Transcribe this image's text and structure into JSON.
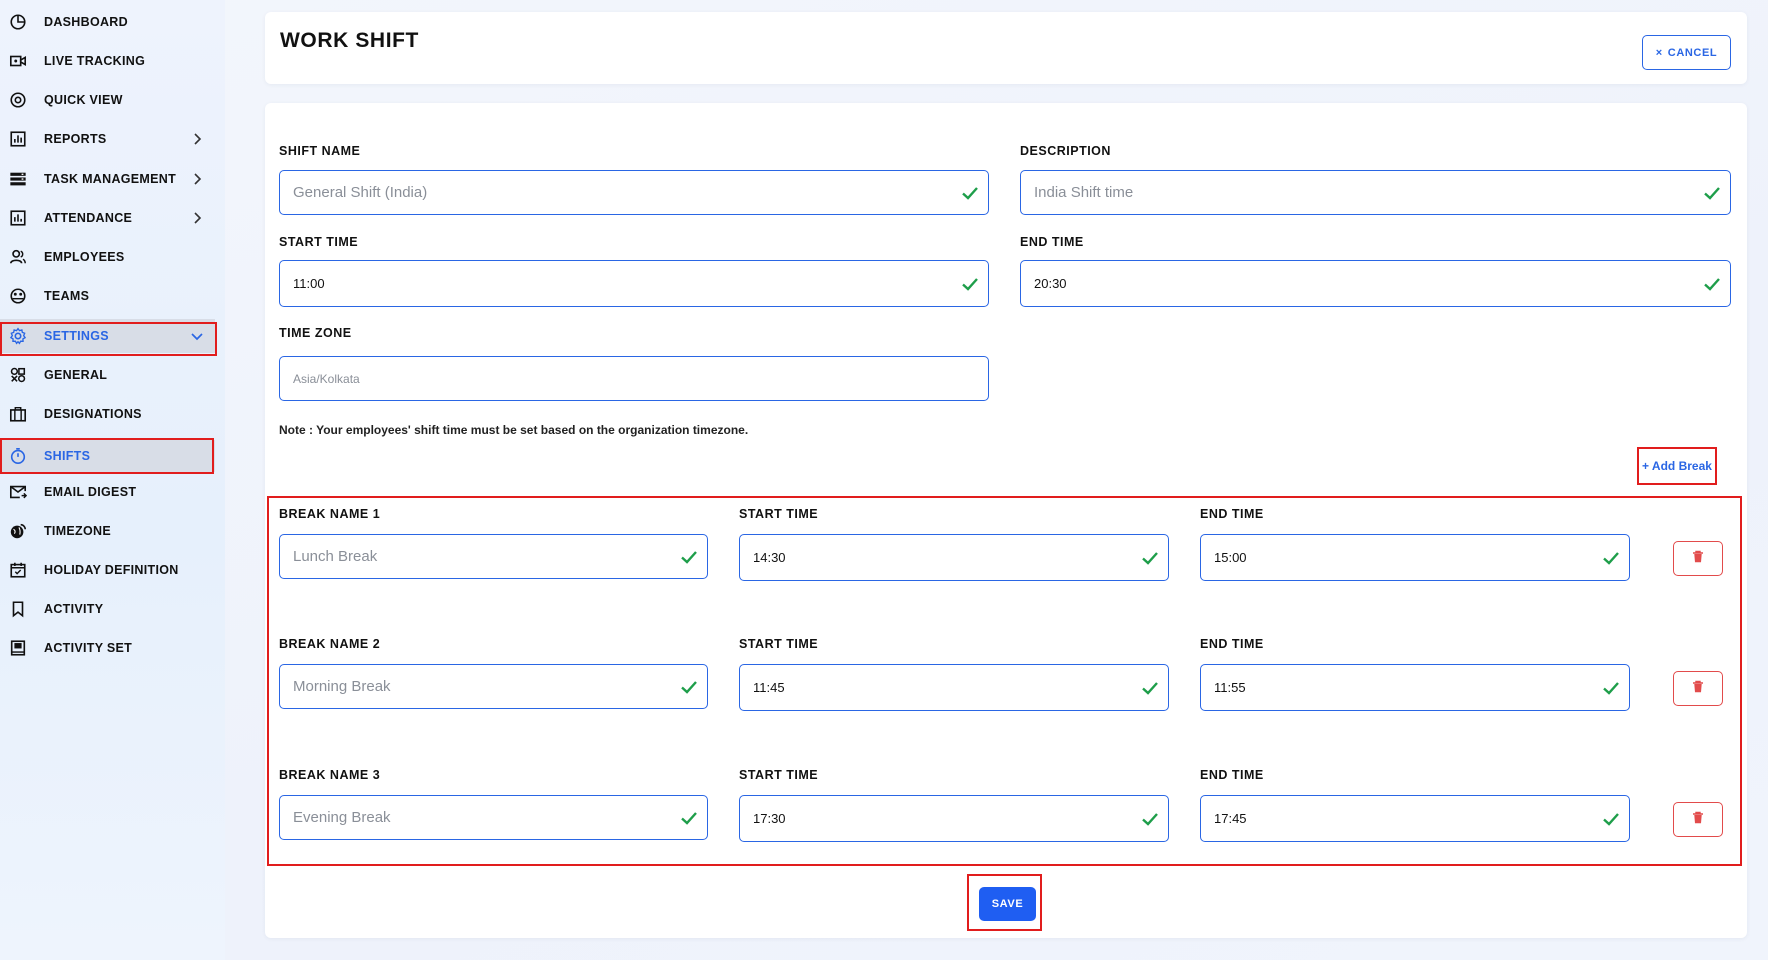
{
  "sidebar": {
    "items": [
      {
        "label": "DASHBOARD",
        "icon": "clock-pie-icon"
      },
      {
        "label": "LIVE TRACKING",
        "icon": "video-icon"
      },
      {
        "label": "QUICK VIEW",
        "icon": "eye-icon"
      },
      {
        "label": "REPORTS",
        "icon": "report-chart-icon"
      },
      {
        "label": "TASK MANAGEMENT",
        "icon": "stack-icon"
      },
      {
        "label": "ATTENDANCE",
        "icon": "attendance-chart-icon"
      },
      {
        "label": "EMPLOYEES",
        "icon": "people-icon"
      },
      {
        "label": "TEAMS",
        "icon": "team-icon"
      },
      {
        "label": "SETTINGS",
        "icon": "gear-icon"
      },
      {
        "label": "GENERAL",
        "icon": "general-icon"
      },
      {
        "label": "DESIGNATIONS",
        "icon": "briefcase-icon"
      },
      {
        "label": "SHIFTS",
        "icon": "stopwatch-icon"
      },
      {
        "label": "EMAIL DIGEST",
        "icon": "mail-icon"
      },
      {
        "label": "TIMEZONE",
        "icon": "globe-icon"
      },
      {
        "label": "HOLIDAY DEFINITION",
        "icon": "calendar-icon"
      },
      {
        "label": "ACTIVITY",
        "icon": "bookmark-icon"
      },
      {
        "label": "ACTIVITY SET",
        "icon": "book-icon"
      }
    ]
  },
  "header": {
    "title": "WORK SHIFT",
    "cancel_label": "CANCEL",
    "cancel_icon": "×"
  },
  "form": {
    "shift_name": {
      "label": "SHIFT NAME",
      "value": "General Shift (India)"
    },
    "description": {
      "label": "DESCRIPTION",
      "value": "India Shift time"
    },
    "start_time": {
      "label": "START TIME",
      "value": "11:00"
    },
    "end_time": {
      "label": "END TIME",
      "value": "20:30"
    },
    "time_zone": {
      "label": "TIME ZONE",
      "value": "Asia/Kolkata"
    },
    "note": "Note : Your employees' shift time must be set based on the organization timezone.",
    "add_break_label": "+ Add Break"
  },
  "breaks": [
    {
      "name_label": "BREAK NAME 1",
      "name": "Lunch Break",
      "start_label": "START TIME",
      "start": "14:30",
      "end_label": "END TIME",
      "end": "15:00"
    },
    {
      "name_label": "BREAK NAME 2",
      "name": "Morning Break",
      "start_label": "START TIME",
      "start": "11:45",
      "end_label": "END TIME",
      "end": "11:55"
    },
    {
      "name_label": "BREAK NAME 3",
      "name": "Evening Break",
      "start_label": "START TIME",
      "start": "17:30",
      "end_label": "END TIME",
      "end": "17:45"
    }
  ],
  "save_label": "SAVE",
  "colors": {
    "accent": "#2a66e4",
    "primary_button": "#1f5ef2",
    "success_check": "#1e9e4a",
    "danger": "#e24b4b",
    "highlight": "#e11d1d"
  }
}
